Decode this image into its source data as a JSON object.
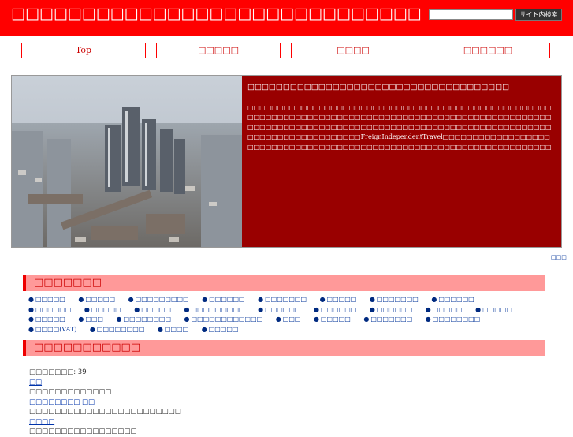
{
  "header": {
    "site_title": "□□□□□□□□□□□□□□□□□□□□□□□□□□□□□□□□□□□",
    "search_placeholder": "",
    "search_button": "サイト内検索"
  },
  "nav": {
    "items": [
      "Top",
      "□□□□□",
      "□□□□",
      "□□□□□□"
    ]
  },
  "hero": {
    "title": "□□□□□□□□□□□□□□□□□□□□□□□□□□□□□□□□□□□□□",
    "body": "□□□□□□□□□□□□□□□□□□□□□□□□□□□□□□□□□□□□□□□□□□□□□□□□□□□□□□□□□□□□□□□□□□□□□□□□□□□□□□□□□□□□□□□□□□□□□□□□□□□□□□□□□□□□□□□□□□□□□□□□□□□□□□□□□□□□□□□□□□□□□□□□□□□□□□□□□□□□□□□□□□□□□□□□□□□□FreignIndependentTravel□□□□□□□□□□□□□□□□□□□□□□□□□□□□□□□□□□□□□□□□□□□□□□□□□□□□□□□□□□□□□□□□□□□□□□□□□□□□□□□□□□□□□□□□□□□□□□□□□□□□□□□□□□□□□□□□□□□□□□□□□□□□□□□□"
  },
  "more_link": "□□□",
  "categories": {
    "heading": "□□□□□□□",
    "items": [
      "□□□□□",
      "□□□□□",
      "□□□□□□□□□",
      "□□□□□□",
      "□□□□□□□",
      "□□□□□",
      "□□□□□□□",
      "□□□□□□",
      "□□□□□□",
      "□□□□□",
      "□□□□□",
      "□□□□□□□□□",
      "□□□□□□",
      "□□□□□□",
      "□□□□□□",
      "□□□□□",
      "□□□□□",
      "□□□□□",
      "□□□",
      "□□□□□□□□",
      "□□□□□□□□□□□□",
      "□□□",
      "□□□□□",
      "□□□□□□□",
      "□□□□□□□□",
      "□□□□(VAT)",
      "□□□□□□□□",
      "□□□□",
      "□□□□□"
    ]
  },
  "recent": {
    "heading": "□□□□□□□□□□□",
    "count_label": "□□□□□□□: 39",
    "entries": [
      {
        "link": "□□",
        "text": "□□□□□□□□□□□□□"
      },
      {
        "link": "□□□□□□□□ □□",
        "text": "□□□□□□□□□□□□□□□□□□□□□□□□"
      },
      {
        "link": "□□□□",
        "text": "□□□□□□□□□□□□□□□□□"
      }
    ]
  },
  "colors": {
    "header_bg": "#ff0000",
    "hero_panel_bg": "#990000",
    "section_head_bg": "#ff9999",
    "link": "#003399"
  }
}
